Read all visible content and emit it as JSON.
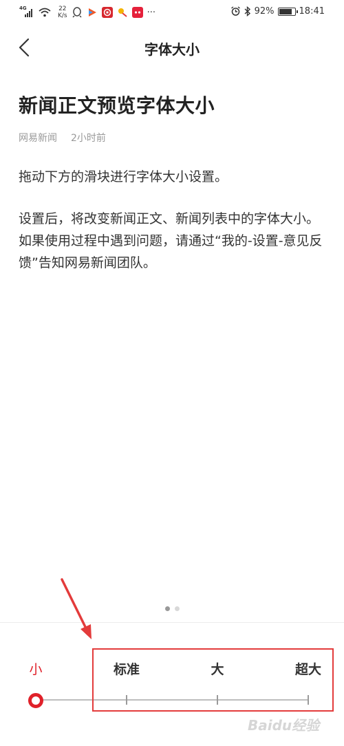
{
  "status_bar": {
    "network": "4G",
    "speed_value": "22",
    "speed_unit": "K/s",
    "app_icons": [
      "qq-icon",
      "video-icon",
      "bank-icon",
      "store-icon",
      "tmall-icon"
    ],
    "more": "···",
    "battery": "92%",
    "battery_level": 0.92,
    "time": "18:41"
  },
  "nav": {
    "title": "字体大小"
  },
  "article": {
    "title": "新闻正文预览字体大小",
    "source": "网易新闻",
    "time": "2小时前",
    "paragraphs": [
      "拖动下方的滑块进行字体大小设置。",
      "设置后，将改变新闻正文、新闻列表中的字体大小。如果使用过程中遇到问题，请通过“我的-设置-意见反馈”告知网易新闻团队。"
    ]
  },
  "pager": {
    "count": 2,
    "active_index": 0
  },
  "font_slider": {
    "options": [
      "小",
      "标准",
      "大",
      "超大"
    ],
    "selected_index": 0,
    "accent_color": "#e0212a"
  },
  "annotation": {
    "color": "#e33b3b"
  },
  "watermark": "Baidu经验"
}
